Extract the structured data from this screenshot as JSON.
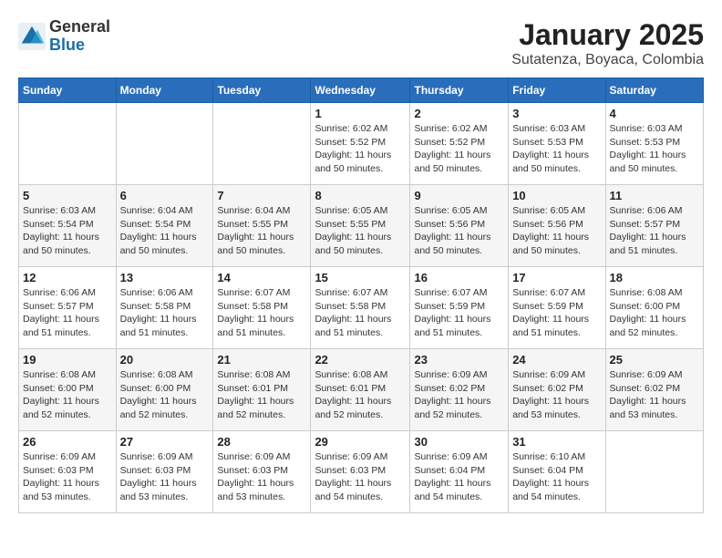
{
  "header": {
    "logo_general": "General",
    "logo_blue": "Blue",
    "title": "January 2025",
    "subtitle": "Sutatenza, Boyaca, Colombia"
  },
  "weekdays": [
    "Sunday",
    "Monday",
    "Tuesday",
    "Wednesday",
    "Thursday",
    "Friday",
    "Saturday"
  ],
  "weeks": [
    [
      {
        "day": "",
        "info": ""
      },
      {
        "day": "",
        "info": ""
      },
      {
        "day": "",
        "info": ""
      },
      {
        "day": "1",
        "info": "Sunrise: 6:02 AM\nSunset: 5:52 PM\nDaylight: 11 hours and 50 minutes."
      },
      {
        "day": "2",
        "info": "Sunrise: 6:02 AM\nSunset: 5:52 PM\nDaylight: 11 hours and 50 minutes."
      },
      {
        "day": "3",
        "info": "Sunrise: 6:03 AM\nSunset: 5:53 PM\nDaylight: 11 hours and 50 minutes."
      },
      {
        "day": "4",
        "info": "Sunrise: 6:03 AM\nSunset: 5:53 PM\nDaylight: 11 hours and 50 minutes."
      }
    ],
    [
      {
        "day": "5",
        "info": "Sunrise: 6:03 AM\nSunset: 5:54 PM\nDaylight: 11 hours and 50 minutes."
      },
      {
        "day": "6",
        "info": "Sunrise: 6:04 AM\nSunset: 5:54 PM\nDaylight: 11 hours and 50 minutes."
      },
      {
        "day": "7",
        "info": "Sunrise: 6:04 AM\nSunset: 5:55 PM\nDaylight: 11 hours and 50 minutes."
      },
      {
        "day": "8",
        "info": "Sunrise: 6:05 AM\nSunset: 5:55 PM\nDaylight: 11 hours and 50 minutes."
      },
      {
        "day": "9",
        "info": "Sunrise: 6:05 AM\nSunset: 5:56 PM\nDaylight: 11 hours and 50 minutes."
      },
      {
        "day": "10",
        "info": "Sunrise: 6:05 AM\nSunset: 5:56 PM\nDaylight: 11 hours and 50 minutes."
      },
      {
        "day": "11",
        "info": "Sunrise: 6:06 AM\nSunset: 5:57 PM\nDaylight: 11 hours and 51 minutes."
      }
    ],
    [
      {
        "day": "12",
        "info": "Sunrise: 6:06 AM\nSunset: 5:57 PM\nDaylight: 11 hours and 51 minutes."
      },
      {
        "day": "13",
        "info": "Sunrise: 6:06 AM\nSunset: 5:58 PM\nDaylight: 11 hours and 51 minutes."
      },
      {
        "day": "14",
        "info": "Sunrise: 6:07 AM\nSunset: 5:58 PM\nDaylight: 11 hours and 51 minutes."
      },
      {
        "day": "15",
        "info": "Sunrise: 6:07 AM\nSunset: 5:58 PM\nDaylight: 11 hours and 51 minutes."
      },
      {
        "day": "16",
        "info": "Sunrise: 6:07 AM\nSunset: 5:59 PM\nDaylight: 11 hours and 51 minutes."
      },
      {
        "day": "17",
        "info": "Sunrise: 6:07 AM\nSunset: 5:59 PM\nDaylight: 11 hours and 51 minutes."
      },
      {
        "day": "18",
        "info": "Sunrise: 6:08 AM\nSunset: 6:00 PM\nDaylight: 11 hours and 52 minutes."
      }
    ],
    [
      {
        "day": "19",
        "info": "Sunrise: 6:08 AM\nSunset: 6:00 PM\nDaylight: 11 hours and 52 minutes."
      },
      {
        "day": "20",
        "info": "Sunrise: 6:08 AM\nSunset: 6:00 PM\nDaylight: 11 hours and 52 minutes."
      },
      {
        "day": "21",
        "info": "Sunrise: 6:08 AM\nSunset: 6:01 PM\nDaylight: 11 hours and 52 minutes."
      },
      {
        "day": "22",
        "info": "Sunrise: 6:08 AM\nSunset: 6:01 PM\nDaylight: 11 hours and 52 minutes."
      },
      {
        "day": "23",
        "info": "Sunrise: 6:09 AM\nSunset: 6:02 PM\nDaylight: 11 hours and 52 minutes."
      },
      {
        "day": "24",
        "info": "Sunrise: 6:09 AM\nSunset: 6:02 PM\nDaylight: 11 hours and 53 minutes."
      },
      {
        "day": "25",
        "info": "Sunrise: 6:09 AM\nSunset: 6:02 PM\nDaylight: 11 hours and 53 minutes."
      }
    ],
    [
      {
        "day": "26",
        "info": "Sunrise: 6:09 AM\nSunset: 6:03 PM\nDaylight: 11 hours and 53 minutes."
      },
      {
        "day": "27",
        "info": "Sunrise: 6:09 AM\nSunset: 6:03 PM\nDaylight: 11 hours and 53 minutes."
      },
      {
        "day": "28",
        "info": "Sunrise: 6:09 AM\nSunset: 6:03 PM\nDaylight: 11 hours and 53 minutes."
      },
      {
        "day": "29",
        "info": "Sunrise: 6:09 AM\nSunset: 6:03 PM\nDaylight: 11 hours and 54 minutes."
      },
      {
        "day": "30",
        "info": "Sunrise: 6:09 AM\nSunset: 6:04 PM\nDaylight: 11 hours and 54 minutes."
      },
      {
        "day": "31",
        "info": "Sunrise: 6:10 AM\nSunset: 6:04 PM\nDaylight: 11 hours and 54 minutes."
      },
      {
        "day": "",
        "info": ""
      }
    ]
  ]
}
